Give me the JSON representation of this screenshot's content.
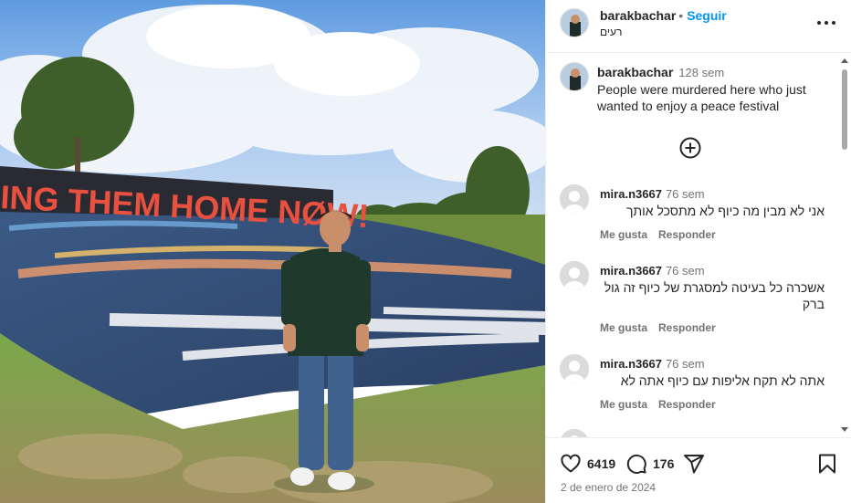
{
  "post": {
    "username": "barakbachar",
    "follow_label": "Seguir",
    "dot": "•",
    "location": "רעים",
    "banner_text": "ING THEM HOME NØW!"
  },
  "caption": {
    "username": "barakbachar",
    "time": "128 sem",
    "text": "People were murdered here who just wanted to enjoy a peace festival"
  },
  "comments": [
    {
      "username": "mira.n3667",
      "time": "76 sem",
      "text": "אני לא מבין מה כיוף לא מתסכל אותך",
      "like_label": "Me gusta",
      "reply_label": "Responder"
    },
    {
      "username": "mira.n3667",
      "time": "76 sem",
      "text": "אשכרה כל בעיטה למסגרת של כיוף זה גול ברק",
      "like_label": "Me gusta",
      "reply_label": "Responder"
    },
    {
      "username": "mira.n3667",
      "time": "76 sem",
      "text": "אתה לא תקח אליפות עם כיוף אתה לא",
      "like_label": "Me gusta",
      "reply_label": "Responder"
    }
  ],
  "stats": {
    "likes": "6419",
    "comments": "176"
  },
  "date": "2 de enero de 2024",
  "icons": {
    "more": "more-options-icon",
    "add": "plus-circle-icon",
    "like": "heart-icon",
    "comment": "comment-bubble-icon",
    "share": "paper-plane-icon",
    "save": "bookmark-icon"
  },
  "colors": {
    "link_blue": "#0095f6",
    "text": "#262626",
    "secondary": "#737373",
    "banner_red": "#e8513f"
  }
}
